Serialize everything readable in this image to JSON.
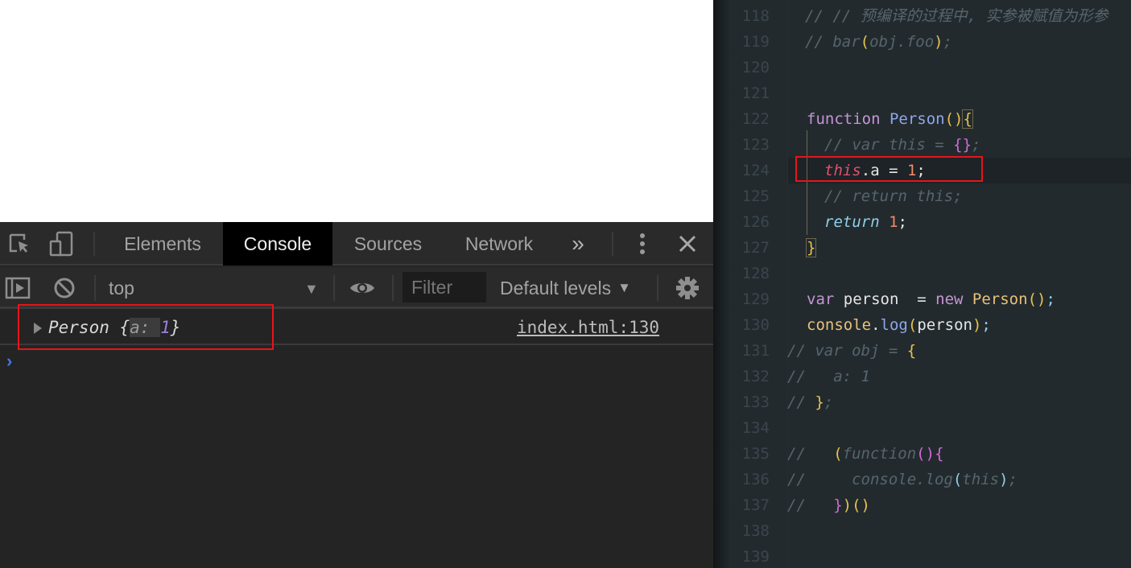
{
  "devtools": {
    "tabs": [
      {
        "label": "Elements",
        "active": false
      },
      {
        "label": "Console",
        "active": true
      },
      {
        "label": "Sources",
        "active": false
      },
      {
        "label": "Network",
        "active": false
      }
    ],
    "more_tabs_label": "»",
    "toolbar": {
      "context": "top",
      "filter_placeholder": "Filter",
      "levels": "Default levels"
    },
    "console": {
      "entry": {
        "class_name": "Person",
        "open_brace": " {",
        "key": "a: ",
        "value": "1",
        "close_brace": "}",
        "source": "index.html:130"
      },
      "prompt": "›"
    }
  },
  "editor": {
    "lines": [
      {
        "n": "118"
      },
      {
        "n": "119"
      },
      {
        "n": "120"
      },
      {
        "n": "121"
      },
      {
        "n": "122"
      },
      {
        "n": "123"
      },
      {
        "n": "124"
      },
      {
        "n": "125"
      },
      {
        "n": "126"
      },
      {
        "n": "127"
      },
      {
        "n": "128"
      },
      {
        "n": "129"
      },
      {
        "n": "130"
      },
      {
        "n": "131"
      },
      {
        "n": "132"
      },
      {
        "n": "133"
      },
      {
        "n": "134"
      },
      {
        "n": "135"
      },
      {
        "n": "136"
      },
      {
        "n": "137"
      },
      {
        "n": "138"
      },
      {
        "n": "139"
      }
    ],
    "code": {
      "l118": "// // 预编译的过程中, 实参被赋值为形参",
      "l119_a": "// bar",
      "l119_b": "(",
      "l119_c": "obj.foo",
      "l119_d": ")",
      "l119_e": ";",
      "l122_kw": "function ",
      "l122_name": "Person",
      "l122_paren": "()",
      "l122_brace": "{",
      "l123_a": "// var this = ",
      "l123_b": "{}",
      "l123_c": ";",
      "l124_this": "this",
      "l124_rest": ".a = ",
      "l124_num": "1",
      "l124_semi": ";",
      "l125": "// return this;",
      "l126_ret": "return ",
      "l126_num": "1",
      "l126_semi": ";",
      "l127": "}",
      "l129_kw": "var ",
      "l129_id": "person  = ",
      "l129_new": "new ",
      "l129_cls": "Person",
      "l129_paren": "()",
      "l129_semi": ";",
      "l130_console": "console",
      "l130_dot": ".",
      "l130_log": "log",
      "l130_p1": "(",
      "l130_arg": "person",
      "l130_p2": ")",
      "l130_semi": ";",
      "l131_a": "// var obj = ",
      "l131_b": "{",
      "l132": "//   a: 1",
      "l133_a": "// ",
      "l133_b": "}",
      "l133_c": ";",
      "l135_a": "//   ",
      "l135_b": "(",
      "l135_c": "function",
      "l135_d": "()",
      "l135_e": "{",
      "l136_a": "//     console.log",
      "l136_b": "(",
      "l136_c": "this",
      "l136_d": ")",
      "l136_e": ";",
      "l137_a": "//   ",
      "l137_b": "}",
      "l137_c": ")",
      "l137_d": "()"
    }
  }
}
